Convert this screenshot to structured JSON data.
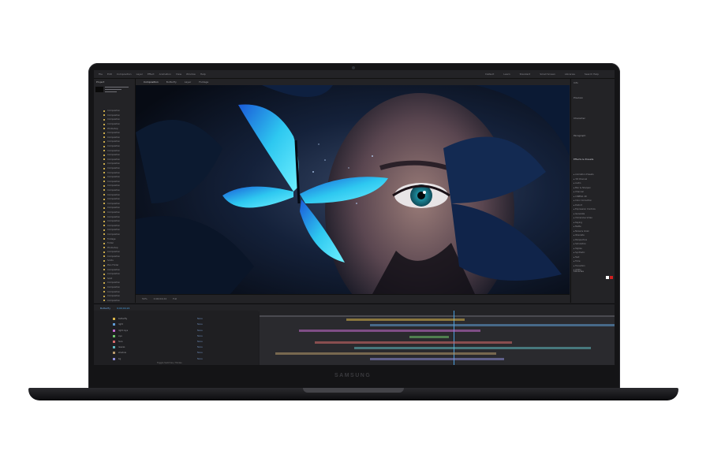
{
  "brand": "SAMSUNG",
  "app": {
    "menu": [
      "File",
      "Edit",
      "Composition",
      "Layer",
      "Effect",
      "Animation",
      "View",
      "Window",
      "Help"
    ],
    "workspaces": [
      "Default",
      "Learn",
      "Standard",
      "Small Screen",
      "Libraries"
    ],
    "search_label": "Search Help",
    "project_panel_title": "Project",
    "comp_tabs": [
      "Composition",
      "Layer",
      "Footage"
    ],
    "active_comp": "Butterfly",
    "viewer_zoom": "50%",
    "viewer_resolution": "Full",
    "viewer_timecode": "0;00;04;24",
    "project_items": [
      "Composition",
      "Composition",
      "Composition",
      "Composition",
      "Photoshop",
      "Composition",
      "Composition",
      "Composition",
      "Composition",
      "Composition",
      "Composition",
      "Composition",
      "Composition",
      "Composition",
      "Composition",
      "Composition",
      "Composition",
      "Composition",
      "Composition",
      "Composition",
      "Composition",
      "Composition",
      "Composition",
      "Composition",
      "Composition",
      "Composition",
      "Composition",
      "Composition",
      "Composition",
      "Footage",
      "Folder",
      "Photoshop",
      "Composition",
      "Composition",
      "Solids",
      "Plan Folder",
      "Composition",
      "Composition",
      "Solid",
      "Composition",
      "Composition",
      "Composition",
      "Composition",
      "Composition",
      "Composition",
      "Composition",
      "Composition"
    ],
    "right_panel": {
      "info": "Info",
      "preview": "Preview",
      "character": "Character",
      "paragraph": "Paragraph",
      "effects": "Effects & Presets",
      "effects_items": [
        "Animation Presets",
        "3D Channel",
        "Audio",
        "Blur & Sharpen",
        "Channel",
        "CINEMA 4D",
        "Color Correction",
        "Distort",
        "Expression Controls",
        "Generate",
        "Immersive Video",
        "Keying",
        "Matte",
        "Noise & Grain",
        "Obsolete",
        "Perspective",
        "Simulation",
        "Stylize",
        "Synthetic",
        "Text",
        "Time",
        "Transition",
        "Utility"
      ],
      "libraries": "Libraries"
    },
    "timeline_tab": "Butterfly",
    "timeline_timecode": "0;00;04;24",
    "layers": [
      "butterfly",
      "light",
      "light rays",
      "eye",
      "face",
      "leaves",
      "shadow",
      "bg"
    ],
    "parent_value": "None",
    "status_text": "Toggle Switches / Modes"
  },
  "colors": {
    "label_colors": [
      "#d9b44a",
      "#5f9cd6",
      "#c46bd0",
      "#6fc46b",
      "#d66b6b",
      "#5fb8c0",
      "#b89a6b",
      "#8b8bd6"
    ],
    "accent": "#4aa0e0"
  }
}
